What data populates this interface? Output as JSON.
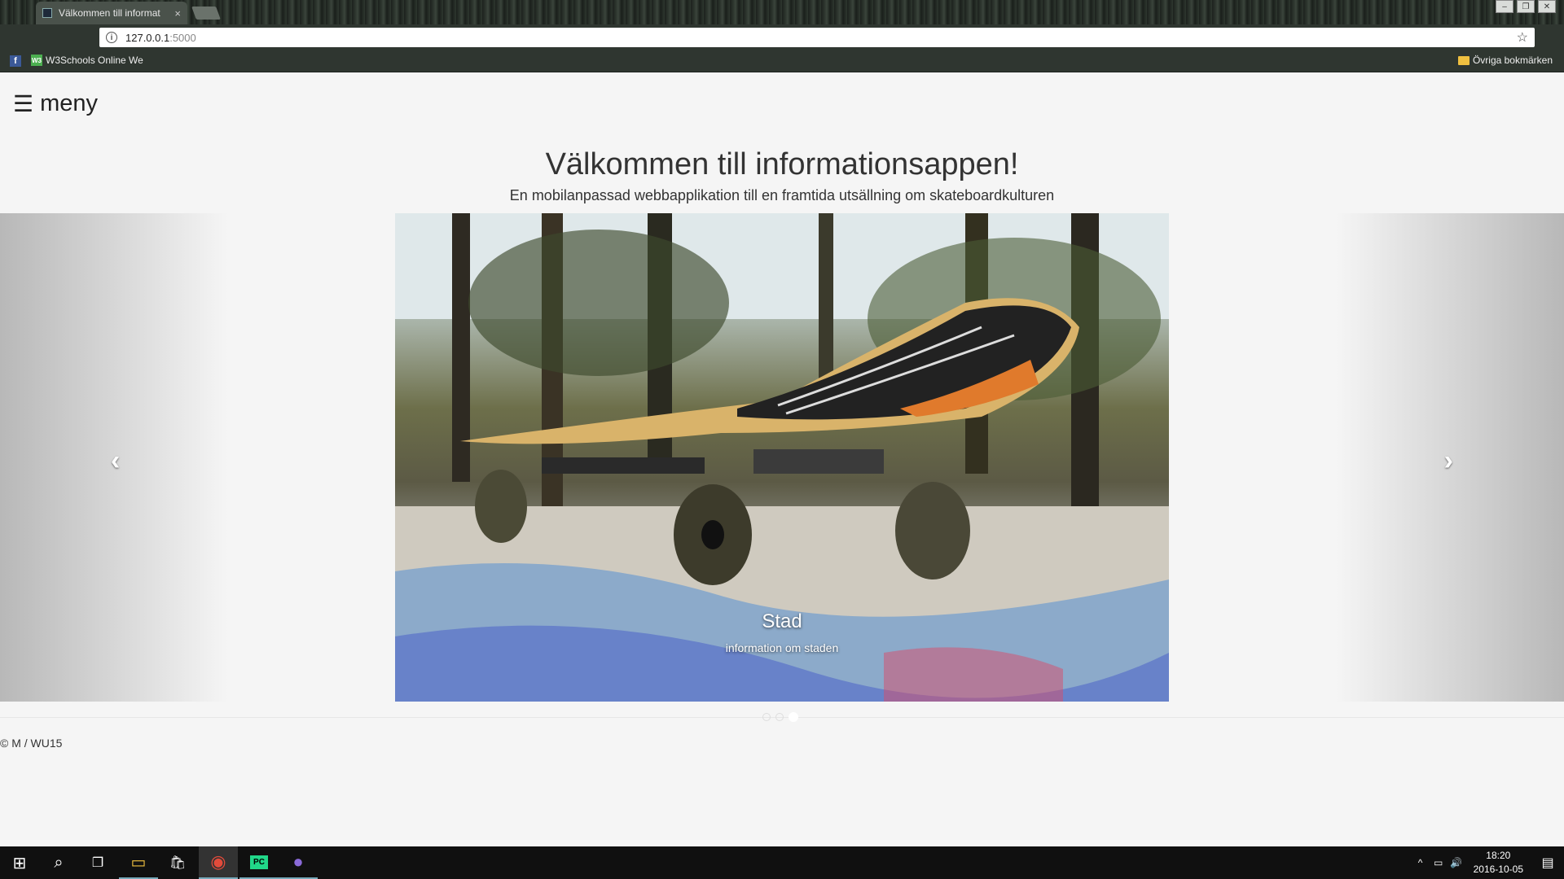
{
  "browser": {
    "tab_title": "Välkommen till informat",
    "tab_close": "×",
    "url_host": "127.0.0.1",
    "url_port": ":5000",
    "info_icon": "i",
    "star_icon": "☆",
    "window_controls": [
      "–",
      "❐",
      "✕"
    ],
    "bookmarks": {
      "facebook_icon": "f",
      "w3_icon": "W3",
      "w3_label": "W3Schools Online We",
      "other_label": "Övriga bokmärken"
    }
  },
  "page": {
    "menu_icon": "☰",
    "menu_label": "meny",
    "title": "Välkommen till informationsappen!",
    "subtitle": "En mobilanpassad webbapplikation till en framtida utsällning om skateboardkulturen",
    "carousel": {
      "prev_icon": "‹",
      "next_icon": "›",
      "caption_title": "Stad",
      "caption_text": "information om staden",
      "indicators": 3,
      "active_index": 2
    },
    "footer": "© M / WU15"
  },
  "taskbar": {
    "start_icon": "⊞",
    "search_icon": "⌕",
    "taskview_icon": "❐",
    "explorer_icon": "▭",
    "store_icon": "🛍",
    "chrome_icon": "◉",
    "pycharm_icon": "PC",
    "app_icon": "●",
    "tray_up": "^",
    "network_icon": "▭",
    "volume_icon": "🔊",
    "time": "18:20",
    "date": "2016-10-05",
    "notification_icon": "▤"
  },
  "colors": {
    "page_bg": "#f5f5f5",
    "chrome_toolbar": "#2f3630",
    "taskbar": "#101010"
  }
}
